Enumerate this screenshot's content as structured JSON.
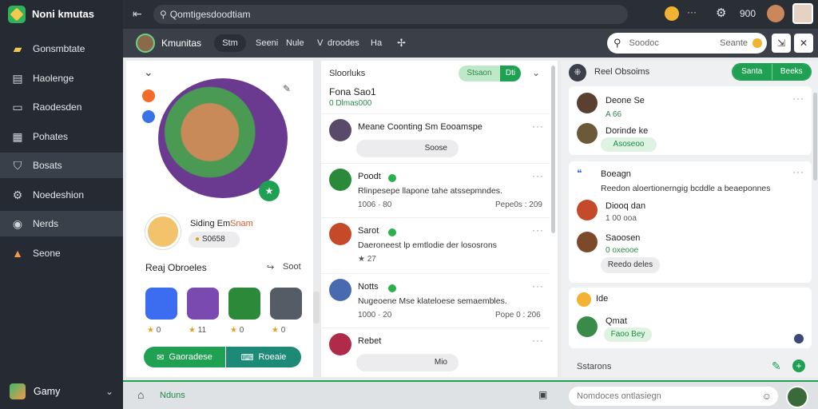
{
  "app": {
    "title": "Noni kmutas"
  },
  "sidebar": {
    "items": [
      {
        "label": "Gonsmbtate",
        "icon": "map-icon",
        "color": "#f2c94c"
      },
      {
        "label": "Haolenge",
        "icon": "news-icon",
        "color": "#cfd4da"
      },
      {
        "label": "Raodesden",
        "icon": "chat-icon",
        "color": "#cfd4da"
      },
      {
        "label": "Pohates",
        "icon": "calendar-icon",
        "color": "#cfd4da"
      },
      {
        "label": "Bosats",
        "icon": "shield-icon",
        "color": "#cfd4da"
      },
      {
        "label": "Noedeshion",
        "icon": "gear-icon",
        "color": "#cfd4da"
      },
      {
        "label": "Nerds",
        "icon": "circle-icon",
        "color": "#cfd4da"
      },
      {
        "label": "Seone",
        "icon": "store-icon",
        "color": "#f2994a"
      }
    ],
    "footer_label": "Gamy"
  },
  "topbar": {
    "search_placeholder": "Qomtigesdoodtiam",
    "count": "900"
  },
  "header": {
    "title": "Kmunitas",
    "tabs": [
      "Stm",
      "Seeni",
      "Nule",
      "V",
      "droodes",
      "Ha"
    ],
    "search_placeholder": "Soodoc",
    "search_label": "Seante"
  },
  "profile": {
    "name": "Siding Em",
    "name_tag": "Snam",
    "stat": "S0658",
    "recent_title": "Reaj Obroeles",
    "recent_link": "Soot",
    "games": [
      {
        "icon": "panda-game-icon",
        "rating": "0",
        "color": "#3c6cf0"
      },
      {
        "icon": "warrior-game-icon",
        "rating": "11",
        "color": "#7a4ab0"
      },
      {
        "icon": "sword-game-icon",
        "rating": "0",
        "color": "#2a8a3a"
      },
      {
        "icon": "gear-game-icon",
        "rating": "0",
        "color": "#555c66"
      }
    ],
    "btn_primary": "Gaoradese",
    "btn_secondary": "Roeaie"
  },
  "feed": {
    "title": "Sloorluks",
    "pinned_title": "Fona Sao1",
    "pinned_sub": "0 Dlmas000",
    "toggle_left": "Stsaon",
    "toggle_right": "Dti",
    "posts": [
      {
        "name": "Meane Coonting Sm Eooamspe",
        "text": "",
        "chip": "Soose",
        "left": "",
        "right": "",
        "online": false
      },
      {
        "name": "Poodt",
        "text": "Rlinpesepe llapone tahe atssepmndes.",
        "chip": "",
        "left": "1006 · 80",
        "right": "Pepe0s : 209",
        "online": true
      },
      {
        "name": "Sarot",
        "text": "Daeroneest lp emtlodie der lososrons",
        "chip": "",
        "left": "★ 27",
        "right": "",
        "online": true
      },
      {
        "name": "Notts",
        "text": "Nugeoene Mse klateloese semaembles.",
        "chip": "",
        "left": "1000 · 20",
        "right": "Pope 0 : 206",
        "online": true
      },
      {
        "name": "Rebet",
        "text": "",
        "chip": "Mio",
        "left": "",
        "right": "",
        "online": false
      }
    ]
  },
  "right": {
    "title": "Reel Obsoims",
    "btn_a": "Santa",
    "btn_b": "Beeks",
    "c1": {
      "name": "Deone Se",
      "name2": "Dorinde ke",
      "sub1": "A 66",
      "chip": "Asoseoo"
    },
    "c2": {
      "title": "Boeagn",
      "text": "Reedon aloertionerngig bcddle a beaeponnes",
      "name1": "Diooq dan",
      "sub1": "1 00 ooa",
      "name2": "Saoosen",
      "sub2": "0 oxeooe",
      "chip": "Reedo deles"
    },
    "c3": {
      "title": "Ide",
      "name": "Qmat",
      "chip": "Faoo Bey"
    },
    "footer_label": "Sstarons",
    "msg_placeholder": "Nomdoces ontlasiegn"
  },
  "bottom": {
    "label": "Nduns"
  },
  "colors": {
    "accent": "#20a052",
    "sidebar": "#262b33"
  }
}
